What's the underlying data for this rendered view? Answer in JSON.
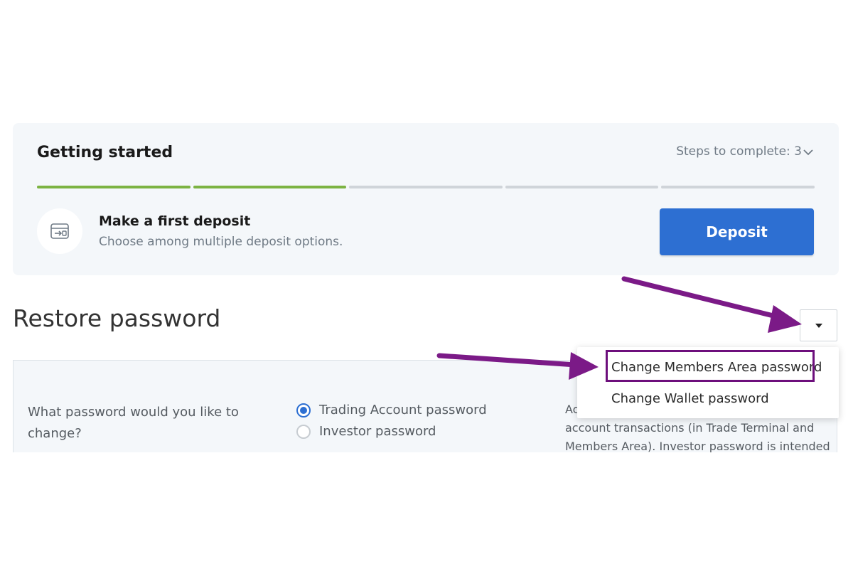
{
  "getting_started": {
    "title": "Getting started",
    "steps_label": "Steps to complete: 3",
    "progress_segments": [
      true,
      true,
      false,
      false,
      false
    ],
    "step_title": "Make a first deposit",
    "step_subtitle": "Choose among multiple deposit options.",
    "deposit_button": "Deposit"
  },
  "restore": {
    "title": "Restore password",
    "question": "What password would you like to change?",
    "options": [
      {
        "label": "Trading Account password",
        "selected": true
      },
      {
        "label": "Investor password",
        "selected": false
      }
    ],
    "info_lines": [
      "Ac",
      "account transactions (in Trade Terminal and",
      "Members Area). Investor password is intended"
    ]
  },
  "dropdown": {
    "items": [
      "Change Members Area password",
      "Change Wallet password"
    ]
  },
  "colors": {
    "accent": "#2d6fd2",
    "progress_done": "#7cb342",
    "annotation": "#7b1a87"
  }
}
